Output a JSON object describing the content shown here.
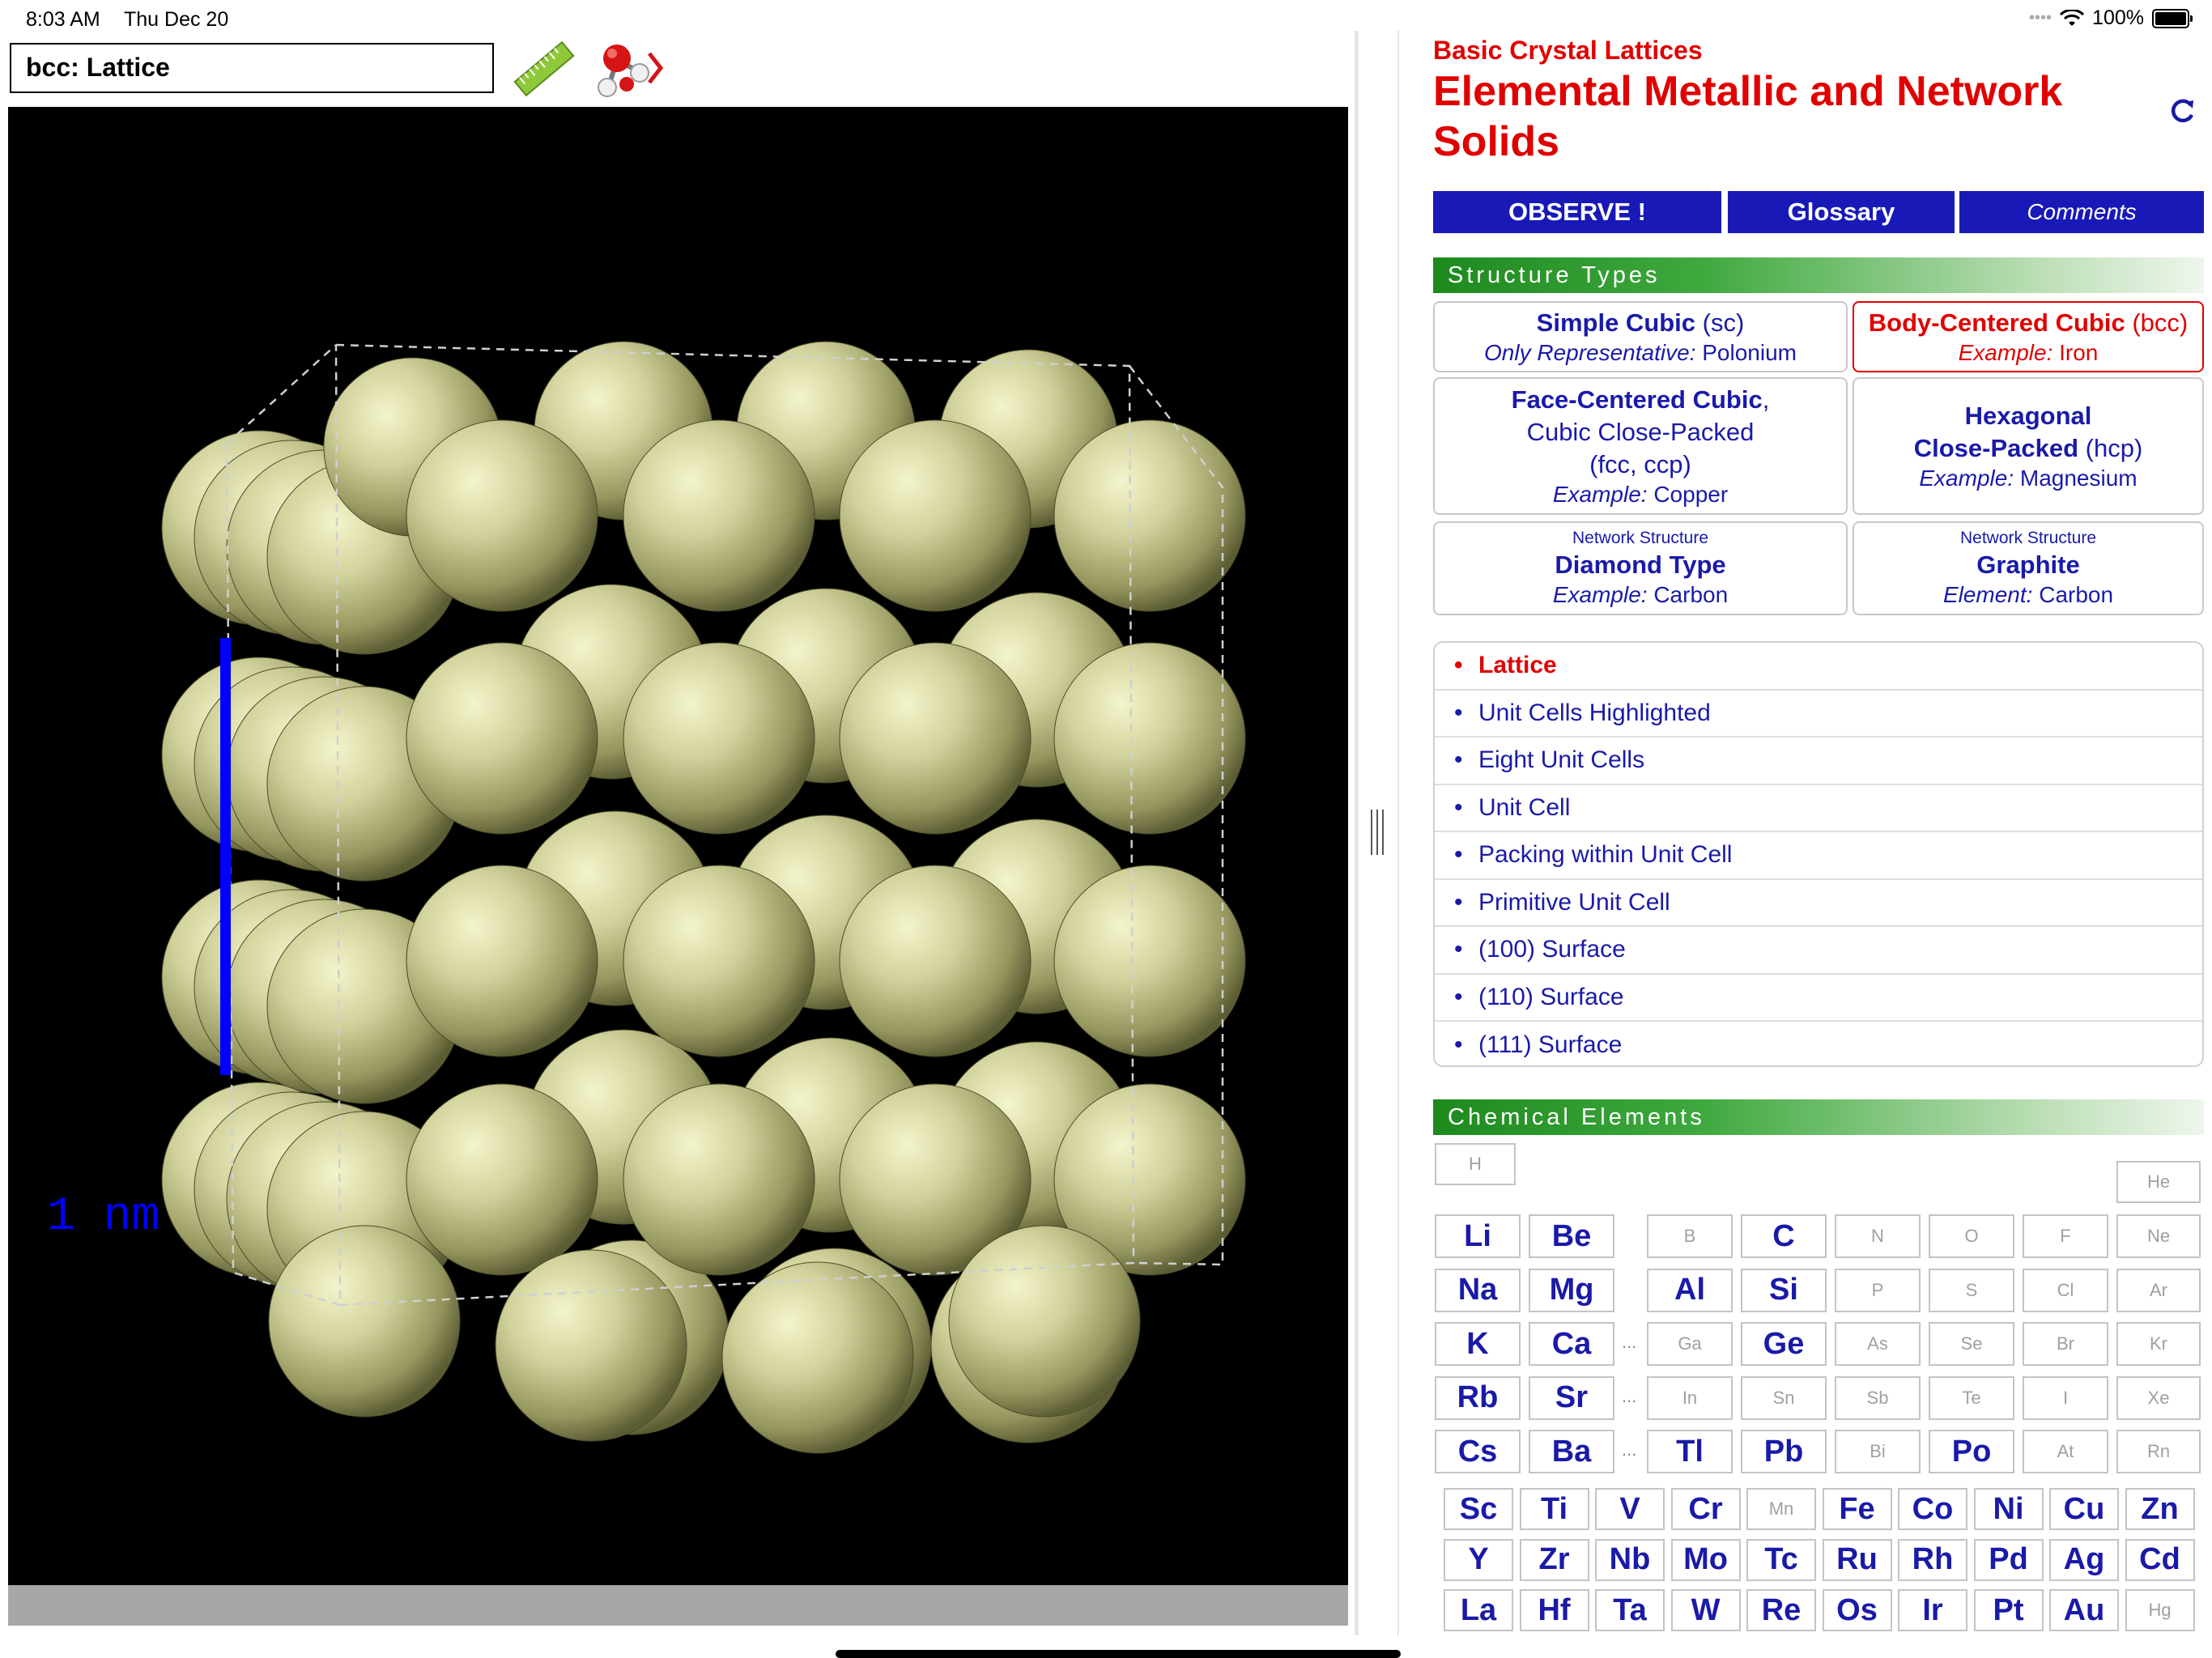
{
  "status": {
    "time": "8:03 AM",
    "date": "Thu Dec 20",
    "battery": "100%"
  },
  "viewer": {
    "title": "bcc: Lattice",
    "scale_label": "1 nm",
    "background": "#000000",
    "atom_color": "#c8c890",
    "scale_bar_color": "#0000ff",
    "tool_icons": [
      "ruler-icon",
      "molecule-tools-icon"
    ]
  },
  "right": {
    "subtitle": "Basic Crystal Lattices",
    "title": "Elemental Metallic and Network Solids",
    "buttons": {
      "observe": "OBSERVE !",
      "glossary": "Glossary",
      "comments": "Comments"
    },
    "structure_section": "Structure Types",
    "structures": {
      "sc": {
        "name": "Simple Cubic",
        "abbr": "(sc)",
        "example_label": "Only Representative:",
        "example": "Polonium"
      },
      "bcc": {
        "name": "Body-Centered Cubic",
        "abbr": "(bcc)",
        "example_label": "Example:",
        "example": "Iron"
      },
      "fcc": {
        "name": "Face-Centered Cubic",
        "line2": "Cubic Close-Packed",
        "abbr": "(fcc, ccp)",
        "example_label": "Example:",
        "example": "Copper"
      },
      "hcp": {
        "name1": "Hexagonal",
        "name2": "Close-Packed",
        "abbr": "(hcp)",
        "example_label": "Example:",
        "example": "Magnesium"
      },
      "diamond": {
        "small": "Network Structure",
        "name": "Diamond Type",
        "example_label": "Example:",
        "example": "Carbon"
      },
      "graphite": {
        "small": "Network Structure",
        "name": "Graphite",
        "example_label": "Element:",
        "example": "Carbon"
      }
    },
    "views": [
      {
        "label": "Lattice",
        "active": true
      },
      {
        "label": "Unit Cells Highlighted",
        "active": false
      },
      {
        "label": "Eight Unit Cells",
        "active": false
      },
      {
        "label": "Unit Cell",
        "active": false
      },
      {
        "label": "Packing within Unit Cell",
        "active": false
      },
      {
        "label": "Primitive Unit Cell",
        "active": false
      },
      {
        "label": "(100) Surface",
        "active": false
      },
      {
        "label": "(110) Surface",
        "active": false
      },
      {
        "label": "(111) Surface",
        "active": false
      }
    ],
    "elements_section": "Chemical Elements",
    "periodic": {
      "H": "H",
      "He": "He",
      "row2": [
        "Li",
        "Be",
        "B",
        "C",
        "N",
        "O",
        "F",
        "Ne"
      ],
      "row3": [
        "Na",
        "Mg",
        "Al",
        "Si",
        "P",
        "S",
        "Cl",
        "Ar"
      ],
      "row4": [
        "K",
        "Ca",
        "Ga",
        "Ge",
        "As",
        "Se",
        "Br",
        "Kr"
      ],
      "row5": [
        "Rb",
        "Sr",
        "In",
        "Sn",
        "Sb",
        "Te",
        "I",
        "Xe"
      ],
      "row6": [
        "Cs",
        "Ba",
        "Tl",
        "Pb",
        "Bi",
        "Po",
        "At",
        "Rn"
      ],
      "tm1": [
        "Sc",
        "Ti",
        "V",
        "Cr",
        "Mn",
        "Fe",
        "Co",
        "Ni",
        "Cu",
        "Zn"
      ],
      "tm2": [
        "Y",
        "Zr",
        "Nb",
        "Mo",
        "Tc",
        "Ru",
        "Rh",
        "Pd",
        "Ag",
        "Cd"
      ],
      "tm3": [
        "La",
        "Hf",
        "Ta",
        "W",
        "Re",
        "Os",
        "Ir",
        "Pt",
        "Au",
        "Hg"
      ],
      "disabled": [
        "H",
        "He",
        "B",
        "N",
        "O",
        "F",
        "Ne",
        "P",
        "S",
        "Cl",
        "Ar",
        "Ga",
        "As",
        "Se",
        "Br",
        "Kr",
        "In",
        "Sn",
        "Sb",
        "Te",
        "I",
        "Xe",
        "Bi",
        "At",
        "Rn",
        "Mn",
        "Hg"
      ],
      "ellipsis": "..."
    },
    "colors": {
      "title_red": "#e00000",
      "button_blue": "#1919b7",
      "link_blue": "#1a1aa8"
    }
  }
}
